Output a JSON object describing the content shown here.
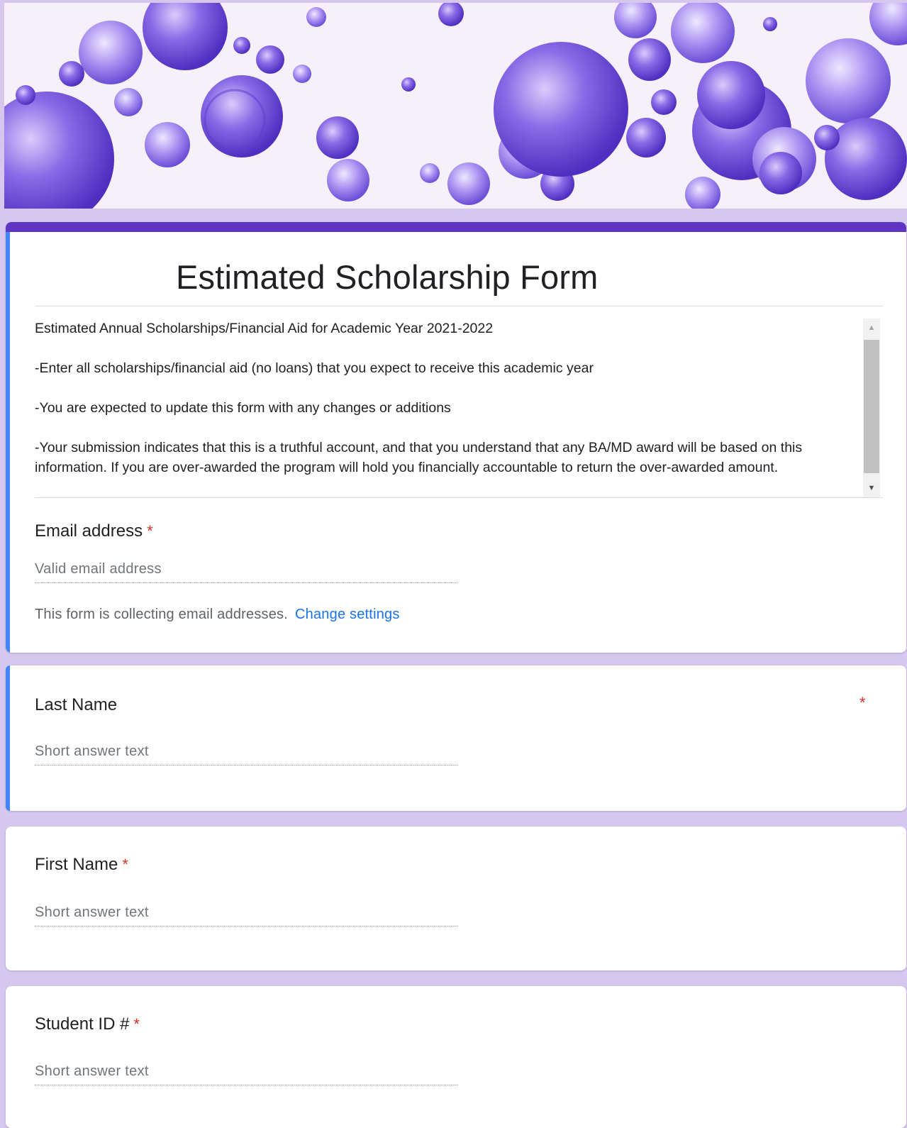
{
  "form": {
    "title": "Estimated Scholarship Form",
    "description": [
      "Estimated Annual Scholarships/Financial Aid for Academic Year 2021-2022",
      "-Enter all scholarships/financial aid (no loans) that you expect to receive this academic year",
      "-You are expected to update this form with any changes or additions",
      "-Your submission indicates that this is a truthful account, and that you understand that any BA/MD award will be based on this information. If you are over-awarded the program will hold you financially accountable to return the over-awarded amount."
    ],
    "email": {
      "label": "Email address",
      "required_mark": "*",
      "placeholder": "Valid email address",
      "note": "This form is collecting email addresses.",
      "note_link": "Change settings"
    }
  },
  "questions": [
    {
      "label": "Last Name",
      "required_mark": "*",
      "placeholder": "Short answer text"
    },
    {
      "label": "First Name",
      "required_mark": "*",
      "placeholder": "Short answer text"
    },
    {
      "label": "Student ID #",
      "required_mark": "*",
      "placeholder": "Short answer text"
    }
  ],
  "colors": {
    "theme": "#5f35c4",
    "background": "#d5c7ed",
    "active_indicator": "#4285f4",
    "required": "#d93025",
    "link": "#1a73e8"
  },
  "icons": [
    "scroll-up-arrow-icon",
    "scroll-down-arrow-icon"
  ]
}
